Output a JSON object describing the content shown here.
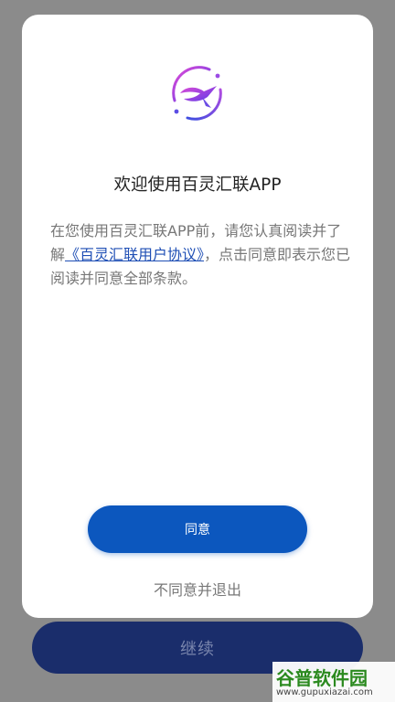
{
  "background": {
    "continue_label": "继续"
  },
  "dialog": {
    "title": "欢迎使用百灵汇联APP",
    "body_pre": "在您使用百灵汇联APP前，请您认真阅读并了解",
    "agreement_link": "《百灵汇联用户协议》",
    "body_post": "，点击同意即表示您已阅读并同意全部条款。",
    "agree_label": "同意",
    "decline_label": "不同意并退出"
  },
  "logo": {
    "icon": "bird-logo-icon"
  },
  "watermark": {
    "brand": "谷普软件园",
    "url": "www.gupuxiazai.com"
  },
  "colors": {
    "primary_button": "#0c57be",
    "link": "#1f4fb5",
    "backdrop": "#8b8b8b",
    "continue_button": "#1a2d6b"
  }
}
